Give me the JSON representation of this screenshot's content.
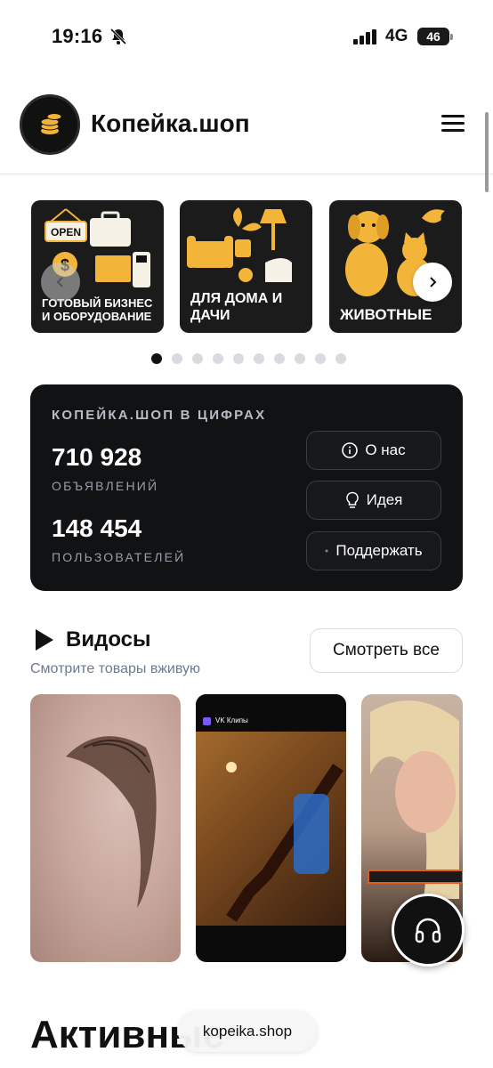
{
  "status_bar": {
    "time": "19:16",
    "network": "4G",
    "battery": "46"
  },
  "header": {
    "brand": "Копейка.шоп"
  },
  "categories": [
    {
      "label": "Готовый бизнес и оборудование",
      "sign": "OPEN"
    },
    {
      "label": "Для дома и дачи"
    },
    {
      "label": "Животные"
    }
  ],
  "carousel": {
    "pages": 10,
    "active": 0
  },
  "stats": {
    "title": "КОПЕЙКА.ШОП В ЦИФРАХ",
    "ads_count": "710 928",
    "ads_label": "ОБЪЯВЛЕНИЙ",
    "users_count": "148 454",
    "users_label": "ПОЛЬЗОВАТЕЛЕЙ",
    "about_label": "О нас",
    "idea_label": "Идея",
    "support_label": "Поддержать"
  },
  "videos": {
    "title": "Видосы",
    "subtitle": "Смотрите товары вживую",
    "see_all": "Смотреть все",
    "vk_label": "VK Клипы"
  },
  "sections": {
    "active_title": "Активные"
  },
  "browser": {
    "url": "kopeika.shop"
  },
  "colors": {
    "accent_gold": "#f2b53a",
    "dark_card": "#111214"
  }
}
